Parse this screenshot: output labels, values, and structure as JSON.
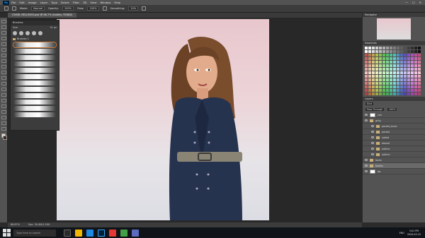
{
  "app": {
    "menu": [
      "File",
      "Edit",
      "Image",
      "Layer",
      "Type",
      "Select",
      "Filter",
      "3D",
      "View",
      "Window",
      "Help"
    ],
    "window_controls": [
      "—",
      "☐",
      "✕"
    ]
  },
  "options": {
    "mode_label": "Mode:",
    "mode_value": "Normal",
    "opacity_label": "Opacity:",
    "opacity_value": "100%",
    "flow_label": "Flow:",
    "flow_value": "100%",
    "smoothing_label": "Smoothing:",
    "smoothing_value": "10%"
  },
  "document": {
    "tab_title": "CHARL BELLINGS.psd @ 66.7% (bodies, RGB/8)"
  },
  "brushes_panel": {
    "title": "Brushes",
    "size_label": "Size",
    "size_value": "31 px",
    "folder_name": "Brushes 1"
  },
  "panels": {
    "navigator": "Navigator",
    "swatches": "Swatches",
    "layers": "Layers"
  },
  "layers": {
    "kind_label": "Kind",
    "blend": "Pass Through",
    "opacity": "100%",
    "items": [
      {
        "name": "cell",
        "type": "layer"
      },
      {
        "name": "grisy",
        "type": "folder"
      },
      {
        "name": "pocket_trunk",
        "type": "folder"
      },
      {
        "name": "pocket",
        "type": "folder"
      },
      {
        "name": "naked",
        "type": "folder"
      },
      {
        "name": "blazed",
        "type": "folder"
      },
      {
        "name": "outline",
        "type": "folder"
      },
      {
        "name": "outline",
        "type": "folder"
      },
      {
        "name": "faces",
        "type": "folder"
      },
      {
        "name": "bodies",
        "type": "folder"
      },
      {
        "name": "bg",
        "type": "layer"
      }
    ]
  },
  "status": {
    "zoom": "66.67%",
    "doc": "Doc: 30.4M/1.00G"
  },
  "taskbar": {
    "search_placeholder": "Type here to search",
    "lang": "ENG",
    "time": "3:01 PM",
    "date": "2020-03-25"
  },
  "colors": {
    "accent": "#31a8ff",
    "panel": "#535353",
    "canvas_bg": "#282828"
  }
}
